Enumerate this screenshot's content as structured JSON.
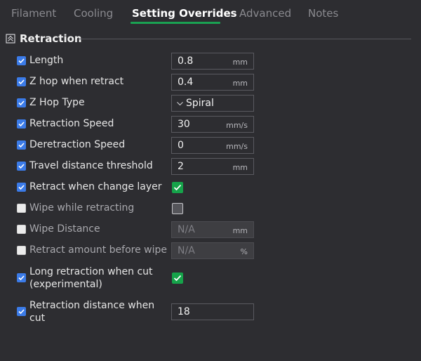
{
  "tabs": [
    {
      "label": "Filament",
      "active": false
    },
    {
      "label": "Cooling",
      "active": false
    },
    {
      "label": "Setting Overrides",
      "active": true
    },
    {
      "label": "Advanced",
      "active": false
    },
    {
      "label": "Notes",
      "active": false
    }
  ],
  "section": {
    "title": "Retraction",
    "icon": "collapse-icon"
  },
  "colors": {
    "accent": "#1aa152",
    "checkbox": "#3b7be8",
    "toggle_on": "#16a34a"
  },
  "settings": [
    {
      "label": "Length",
      "enabled": true,
      "type": "number",
      "value": "0.8",
      "unit": "mm"
    },
    {
      "label": "Z hop when retract",
      "enabled": true,
      "type": "number",
      "value": "0.4",
      "unit": "mm"
    },
    {
      "label": "Z Hop Type",
      "enabled": true,
      "type": "select",
      "value": "Spiral"
    },
    {
      "label": "Retraction Speed",
      "enabled": true,
      "type": "number",
      "value": "30",
      "unit": "mm/s"
    },
    {
      "label": "Deretraction Speed",
      "enabled": true,
      "type": "number",
      "value": "0",
      "unit": "mm/s"
    },
    {
      "label": "Travel distance threshold",
      "enabled": true,
      "type": "number",
      "value": "2",
      "unit": "mm"
    },
    {
      "label": "Retract when change layer",
      "enabled": true,
      "type": "bool",
      "checked": true
    },
    {
      "label": "Wipe while retracting",
      "enabled": false,
      "type": "bool",
      "checked": false
    },
    {
      "label": "Wipe Distance",
      "enabled": false,
      "type": "number",
      "value": "N/A",
      "unit": "mm"
    },
    {
      "label": "Retract amount before wipe",
      "enabled": false,
      "type": "number",
      "value": "N/A",
      "unit": "%"
    },
    {
      "label": "Long retraction when cut (experimental)",
      "enabled": true,
      "type": "bool",
      "checked": true
    },
    {
      "label": "Retraction distance when cut",
      "enabled": true,
      "type": "number",
      "value": "18",
      "unit": ""
    }
  ]
}
